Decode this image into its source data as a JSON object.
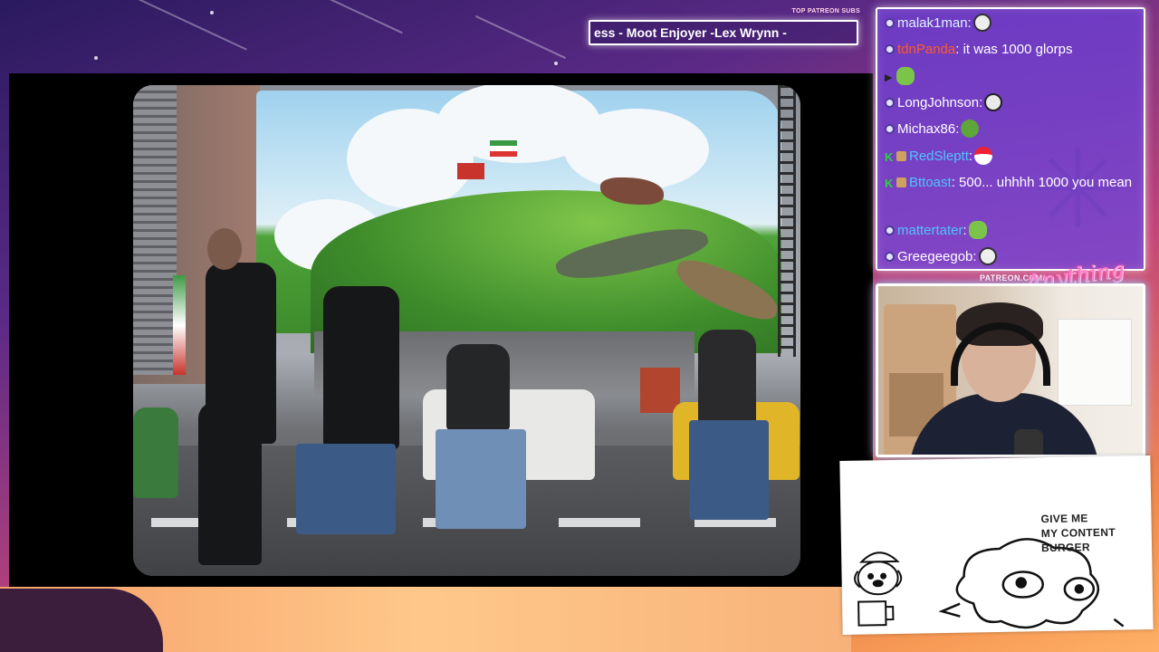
{
  "overlay": {
    "patreon_header": "TOP PATREON SUBS",
    "ticker_text": "ess - Moot Enjoyer -Lex Wrynn -",
    "patreon_url": "PATREON.COM/",
    "logo_text": "Anything Else?"
  },
  "chat": {
    "messages": [
      {
        "badge": "mod",
        "user": "malak1man",
        "user_color": "#dff3ff",
        "text": "",
        "emote": "face-emote"
      },
      {
        "badge": "mod",
        "user": "tdnPanda",
        "user_color": "#ff5a2a",
        "text": "it was 1000 glorps",
        "emote": ""
      },
      {
        "badge": "arrow",
        "user": "",
        "user_color": "#ffffff",
        "text": "",
        "emote": "frog-emote"
      },
      {
        "badge": "mod",
        "user": "LongJohnson",
        "user_color": "#ffffff",
        "text": "",
        "emote": "skull-emote"
      },
      {
        "badge": "mod",
        "user": "Michax86",
        "user_color": "#ffffff",
        "text": "",
        "emote": "pepe-emote"
      },
      {
        "badge": "kick-sub",
        "user": "RedSleptt",
        "user_color": "#4fc3ff",
        "text": "",
        "emote": "hat-emote"
      },
      {
        "badge": "kick-sub",
        "user": "Bttoast",
        "user_color": "#4fc3ff",
        "text": "500... uhhhh 1000 you mean",
        "emote": ""
      },
      {
        "badge": "mod",
        "user": "mattertater",
        "user_color": "#4fc3ff",
        "text": "",
        "emote": "frog-emote"
      },
      {
        "badge": "mod",
        "user": "Greegeegob",
        "user_color": "#ffffff",
        "text": "",
        "emote": "face-emote"
      }
    ]
  },
  "drawing": {
    "line1": "GIVE ME",
    "line2": "MY CONTENT",
    "line3": "BURGER"
  },
  "colors": {
    "chat_bg": "#7a46d2",
    "neon_border": "#ffffff",
    "webcam_glow": "#78dcff"
  }
}
